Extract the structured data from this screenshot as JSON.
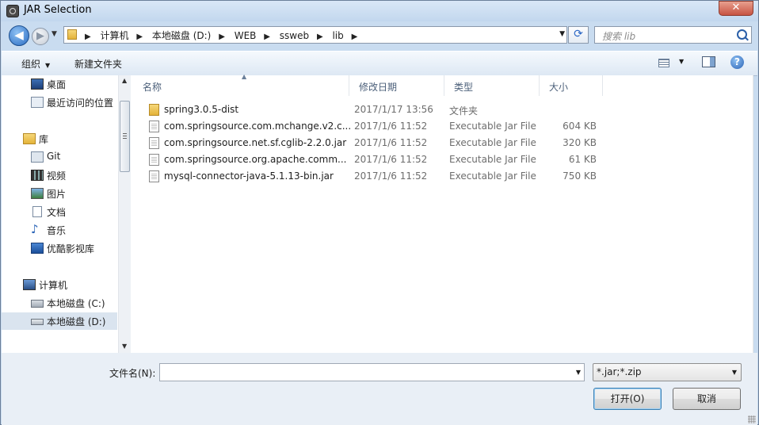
{
  "window": {
    "title": "JAR Selection",
    "close_glyph": "✕"
  },
  "navigation": {
    "back_glyph": "◀",
    "forward_glyph": "▶",
    "breadcrumbs": [
      "计算机",
      "本地磁盘 (D:)",
      "WEB",
      "ssweb",
      "lib"
    ],
    "search_placeholder": "搜索 lib"
  },
  "toolbar": {
    "organize_label": "组织",
    "new_folder_label": "新建文件夹",
    "help_glyph": "?"
  },
  "sidebar": {
    "items": [
      {
        "label": "桌面",
        "icon": "desktop-icon"
      },
      {
        "label": "最近访问的位置",
        "icon": "recent-places-icon"
      },
      {
        "label": "库",
        "icon": "library-icon"
      },
      {
        "label": "Git",
        "icon": "git-library-icon"
      },
      {
        "label": "视频",
        "icon": "video-icon"
      },
      {
        "label": "图片",
        "icon": "pictures-icon"
      },
      {
        "label": "文档",
        "icon": "documents-icon"
      },
      {
        "label": "音乐",
        "icon": "music-icon"
      },
      {
        "label": "优酷影视库",
        "icon": "youku-library-icon"
      },
      {
        "label": "计算机",
        "icon": "computer-icon"
      },
      {
        "label": "本地磁盘 (C:)",
        "icon": "drive-c-icon"
      },
      {
        "label": "本地磁盘 (D:)",
        "icon": "drive-d-icon",
        "selected": true
      }
    ]
  },
  "file_list": {
    "columns": [
      "名称",
      "修改日期",
      "类型",
      "大小"
    ],
    "rows": [
      {
        "name": "spring3.0.5-dist",
        "date": "2017/1/17 13:56",
        "type": "文件夹",
        "size": "",
        "icon": "folder-icon"
      },
      {
        "name": "com.springsource.com.mchange.v2.c...",
        "date": "2017/1/6 11:52",
        "type": "Executable Jar File",
        "size": "604 KB",
        "icon": "jar-file-icon"
      },
      {
        "name": "com.springsource.net.sf.cglib-2.2.0.jar",
        "date": "2017/1/6 11:52",
        "type": "Executable Jar File",
        "size": "320 KB",
        "icon": "jar-file-icon"
      },
      {
        "name": "com.springsource.org.apache.comm...",
        "date": "2017/1/6 11:52",
        "type": "Executable Jar File",
        "size": "61 KB",
        "icon": "jar-file-icon"
      },
      {
        "name": "mysql-connector-java-5.1.13-bin.jar",
        "date": "2017/1/6 11:52",
        "type": "Executable Jar File",
        "size": "750 KB",
        "icon": "jar-file-icon"
      }
    ]
  },
  "footer": {
    "filename_label": "文件名(N):",
    "filename_value": "",
    "filter_value": "*.jar;*.zip",
    "open_label": "打开(O)",
    "cancel_label": "取消"
  },
  "colors": {
    "frame": "#c9dcf0",
    "selection": "#dae4ef",
    "header_text": "#4c607a"
  }
}
